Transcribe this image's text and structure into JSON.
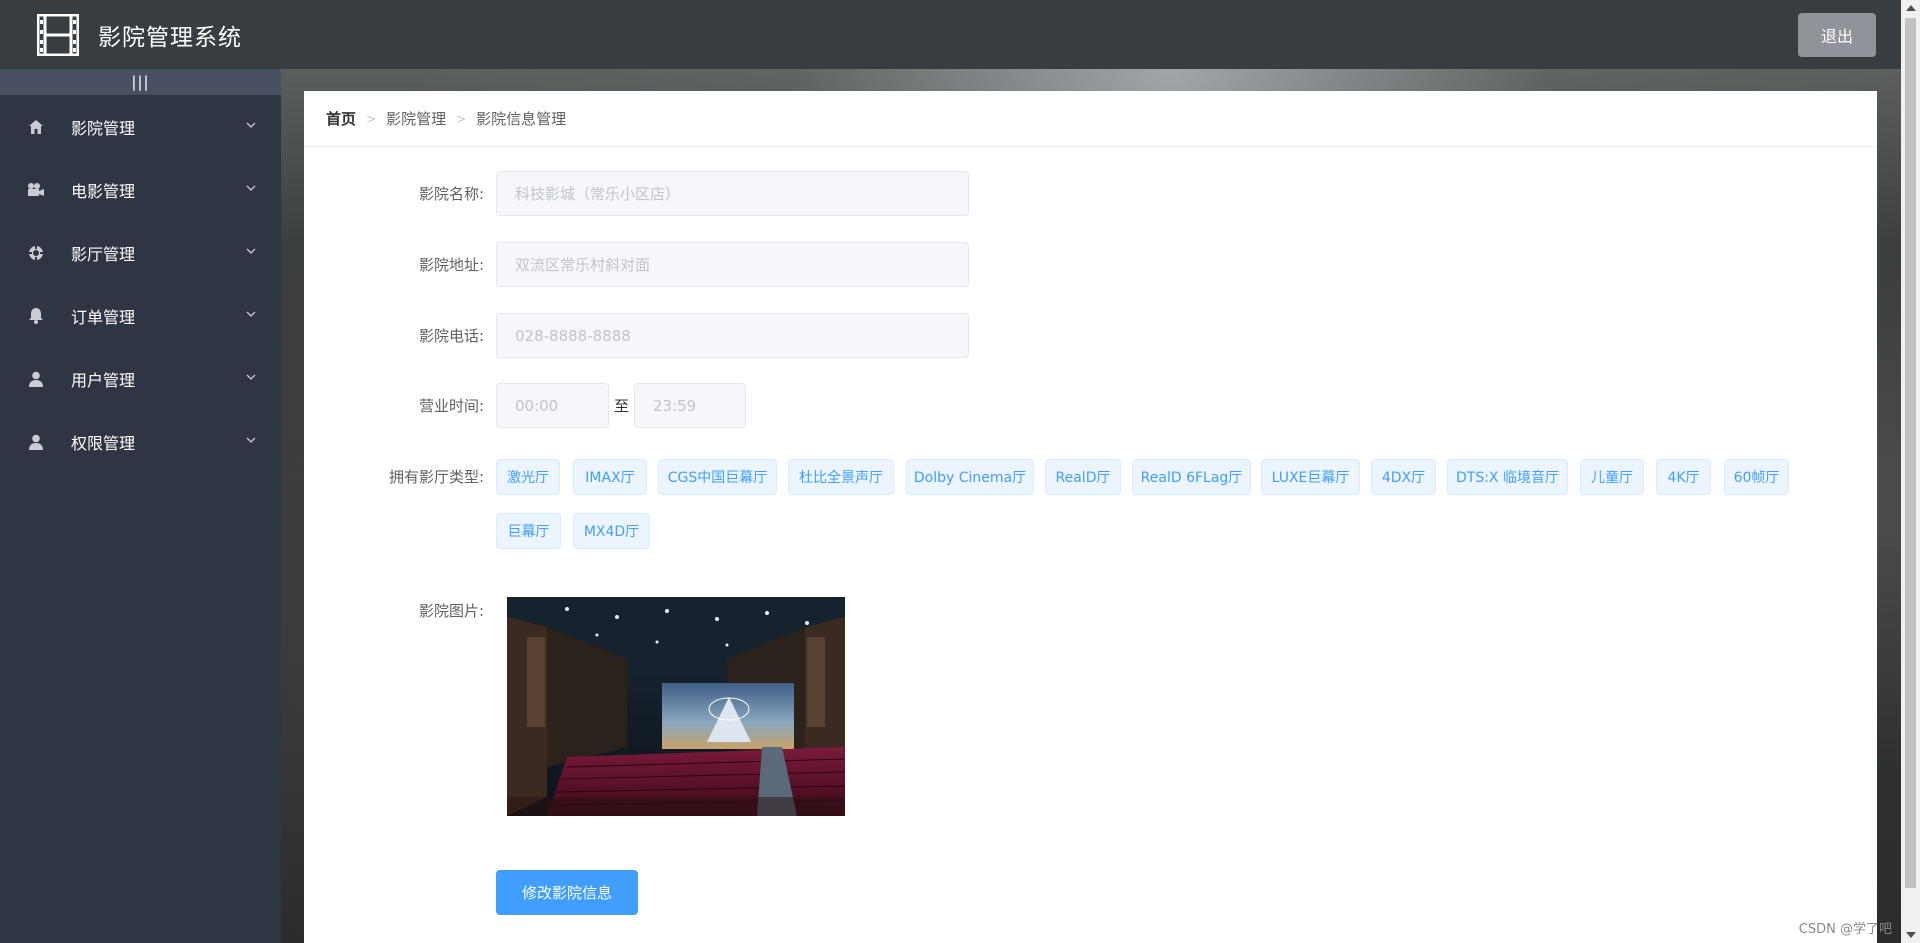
{
  "header": {
    "title": "影院管理系统",
    "logout_label": "退出"
  },
  "sidebar": {
    "collapse_label": "|||",
    "items": [
      {
        "label": "影院管理",
        "icon": "home-icon"
      },
      {
        "label": "电影管理",
        "icon": "camera-icon"
      },
      {
        "label": "影厅管理",
        "icon": "target-icon"
      },
      {
        "label": "订单管理",
        "icon": "bell-icon"
      },
      {
        "label": "用户管理",
        "icon": "user-icon"
      },
      {
        "label": "权限管理",
        "icon": "user-icon"
      }
    ]
  },
  "breadcrumb": {
    "home": "首页",
    "level1": "影院管理",
    "level2": "影院信息管理"
  },
  "form": {
    "name_label": "影院名称:",
    "name_value": "科技影城（常乐小区店）",
    "address_label": "影院地址:",
    "address_value": "双流区常乐村斜对面",
    "phone_label": "影院电话:",
    "phone_value": "028-8888-8888",
    "hours_label": "营业时间:",
    "hours_start": "00:00",
    "hours_to": "至",
    "hours_end": "23:59",
    "hall_types_label": "拥有影厅类型:",
    "hall_types": [
      "激光厅",
      "IMAX厅",
      "CGS中国巨幕厅",
      "杜比全景声厅",
      "Dolby Cinema厅",
      "RealD厅",
      "RealD 6FLag厅",
      "LUXE巨幕厅",
      "4DX厅",
      "DTS:X 临境音厅",
      "儿童厅",
      "4K厅",
      "60帧厅",
      "巨幕厅",
      "MX4D厅"
    ],
    "image_label": "影院图片:",
    "submit_label": "修改影院信息"
  },
  "watermark": "CSDN @学了吧",
  "colors": {
    "header_bg": "#373d41",
    "sidebar_bg": "#2f3542",
    "accent": "#409eff",
    "tag_bg": "#ecf5ff"
  }
}
